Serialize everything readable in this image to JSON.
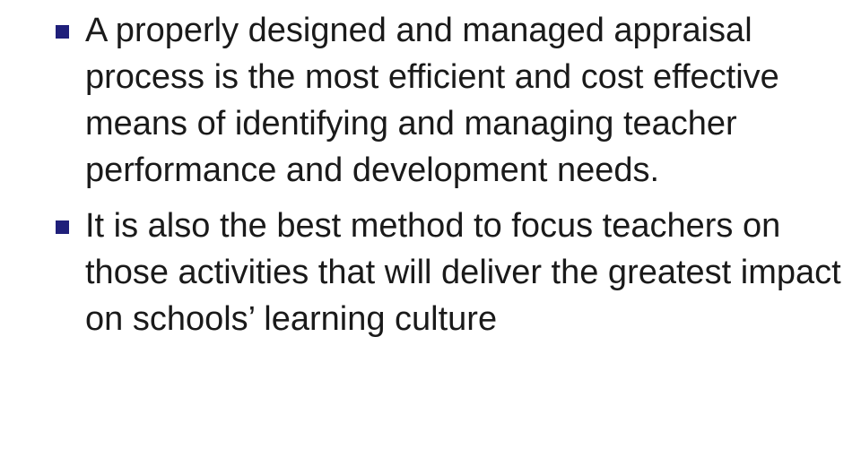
{
  "slide": {
    "bullets": [
      {
        "text": "A properly designed and managed appraisal process is the most efficient and cost effective means of identifying and managing teacher performance and development needs."
      },
      {
        "text": "It is also the best method to focus teachers on those activities that will deliver the greatest impact on schools’ learning culture"
      }
    ]
  },
  "colors": {
    "bullet_marker": "#1f1f7a",
    "text": "#1a1a1a",
    "background": "#ffffff"
  }
}
